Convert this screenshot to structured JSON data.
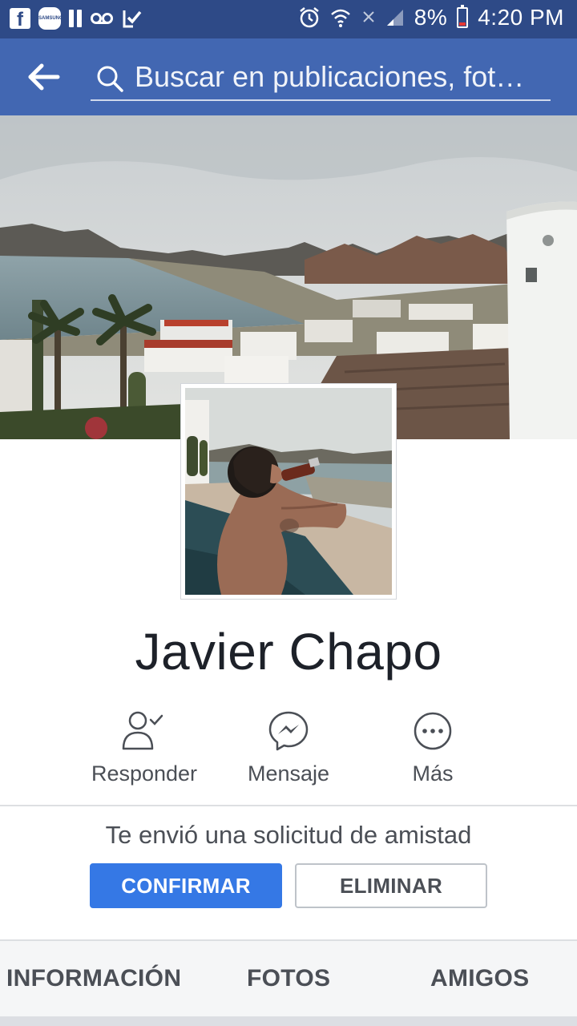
{
  "status_bar": {
    "battery_percent": "8%",
    "time": "4:20 PM",
    "samsung_badge": "SAMSUNG",
    "facebook_glyph": "f",
    "icons": [
      "facebook-notification-icon",
      "samsung-app-icon",
      "pause-icon",
      "voicemail-icon",
      "checklist-icon",
      "alarm-icon",
      "wifi-icon",
      "no-signal-icon",
      "signal-icon",
      "battery-icon"
    ]
  },
  "app_bar": {
    "search_placeholder": "Buscar en publicaciones, fot…",
    "icons": [
      "back-arrow-icon",
      "search-icon"
    ]
  },
  "profile": {
    "name": "Javier Chapo"
  },
  "actions": [
    {
      "label": "Responder",
      "icon": "friend-respond-icon"
    },
    {
      "label": "Mensaje",
      "icon": "messenger-icon"
    },
    {
      "label": "Más",
      "icon": "more-icon"
    }
  ],
  "friend_request": {
    "text": "Te envió una solicitud de amistad",
    "confirm_label": "CONFIRMAR",
    "delete_label": "ELIMINAR"
  },
  "tabs": [
    {
      "label": "INFORMACIÓN"
    },
    {
      "label": "FOTOS"
    },
    {
      "label": "AMIGOS"
    }
  ],
  "colors": {
    "status_bar": "#2e4a87",
    "app_bar": "#4267b2",
    "confirm_button": "#3578e5",
    "text_secondary": "#4b4f56"
  }
}
